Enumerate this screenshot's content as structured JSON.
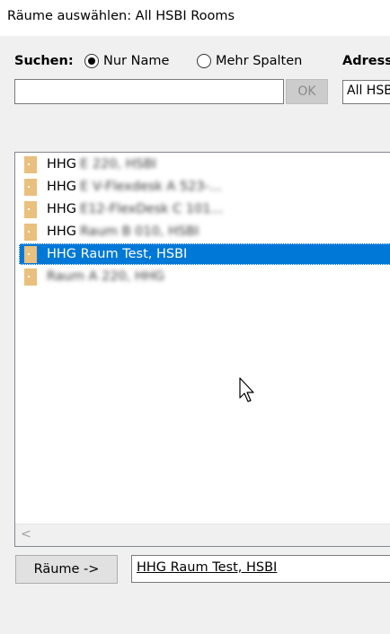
{
  "window": {
    "title": "Räume auswählen: All HSBI Rooms"
  },
  "search": {
    "label": "Suchen:",
    "radio_name_label": "Nur Name",
    "radio_more_label": "Mehr Spalten",
    "selected_radio": "name",
    "input_value": "",
    "ok_label": "OK"
  },
  "addressbook": {
    "label": "Adress",
    "value": "All HSBI"
  },
  "list": {
    "items": [
      {
        "prefix": "HHG",
        "text": "E 220, HSBI",
        "blurred": true,
        "selected": false
      },
      {
        "prefix": "HHG",
        "text": "E V-Flexdesk A 523-...",
        "blurred": true,
        "selected": false
      },
      {
        "prefix": "HHG",
        "text": "E12-FlexDesk C 101...",
        "blurred": true,
        "selected": false
      },
      {
        "prefix": "HHG",
        "text": "Raum B 010, HSBI",
        "blurred": true,
        "selected": false
      },
      {
        "prefix": "",
        "text": "HHG Raum Test, HSBI",
        "blurred": false,
        "selected": true
      },
      {
        "prefix": "",
        "text": "Raum A 220, HHG",
        "blurred": true,
        "selected": false
      }
    ],
    "scroll_left_glyph": "<"
  },
  "bottom": {
    "rooms_button_label": "Räume ->",
    "rooms_value": "HHG Raum Test, HSBI"
  },
  "colors": {
    "selection": "#0078d7",
    "folder_icon": "#e9c07d",
    "window_bg": "#f0f0f0"
  },
  "icons": {
    "list_item_icon": "room-icon",
    "cursor": "mouse-pointer-icon"
  }
}
